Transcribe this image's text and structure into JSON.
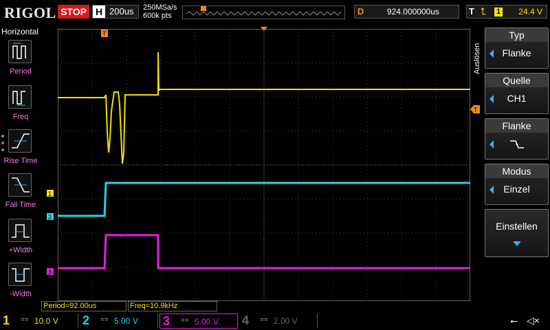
{
  "topbar": {
    "brand": "RIGOL",
    "run_state": "STOP",
    "horizontal": {
      "label": "H",
      "value": "200us"
    },
    "sample_rate": "250MSa/s",
    "memory_depth": "600k pts",
    "delay": {
      "label": "D",
      "value": "924.000000us"
    },
    "trigger": {
      "label": "T",
      "source": "1",
      "level": "24.4 V",
      "edge_icon": "rising-edge-icon"
    }
  },
  "left_menu": {
    "title": "Horizontal",
    "items": [
      {
        "label": "Period",
        "icon": "period-icon"
      },
      {
        "label": "Freq",
        "icon": "freq-icon"
      },
      {
        "label": "Rise Time",
        "icon": "rise-time-icon"
      },
      {
        "label": "Fall Time",
        "icon": "fall-time-icon"
      },
      {
        "label": "+Width",
        "icon": "pos-width-icon"
      },
      {
        "label": "-Width",
        "icon": "neg-width-icon"
      }
    ]
  },
  "right_menu": {
    "side_label": "Auslösen",
    "items": [
      {
        "title": "Typ",
        "value": "Flanke"
      },
      {
        "title": "Quelle",
        "value": "CH1"
      },
      {
        "title": "Flanke",
        "value": "",
        "icon": "falling-edge-icon"
      },
      {
        "title": "Modus",
        "value": "Einzel"
      },
      {
        "title": "Einstellen",
        "value": ""
      }
    ]
  },
  "measurements": {
    "period": "Period=92.00us",
    "freq": "Freq=10.9kHz"
  },
  "channel_markers": {
    "ch1": "1",
    "ch2": "2",
    "ch3": "3",
    "trigger_level": "T"
  },
  "channels": [
    {
      "num": "1",
      "coupling": "==",
      "scale": "10.0 V",
      "color": "#f2e200",
      "active": true
    },
    {
      "num": "2",
      "coupling": "==",
      "scale": "5.00 V",
      "color": "#1ed8e8",
      "active": true
    },
    {
      "num": "3",
      "coupling": "==",
      "scale": "5.00 V",
      "color": "#e81ee0",
      "active": true
    },
    {
      "num": "4",
      "coupling": "==",
      "scale": "2.00 V",
      "color": "#666666",
      "active": false
    }
  ],
  "colors": {
    "ch1": "#f2e200",
    "ch2": "#1ed8e8",
    "ch3": "#e81ee0",
    "ch4": "#666666",
    "trigger": "#f08a1a",
    "accent": "#29b6f6",
    "stop": "#d8191f",
    "label_pink": "#f17bdf"
  },
  "status_icons": [
    "usb-icon",
    "speaker-icon"
  ]
}
